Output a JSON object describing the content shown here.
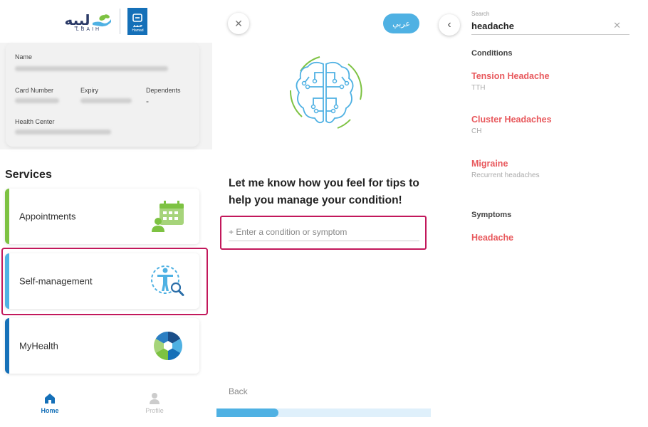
{
  "screen1": {
    "logo": {
      "lbaih_ar": "لبيه",
      "lbaih_en": "LBAIH",
      "hamad_ar": "حمد",
      "hamad_en": "Hamad"
    },
    "card": {
      "name_label": "Name",
      "card_number_label": "Card Number",
      "expiry_label": "Expiry",
      "dependents_label": "Dependents",
      "dependents_value": "-",
      "health_center_label": "Health Center"
    },
    "services_title": "Services",
    "services": [
      {
        "label": "Appointments",
        "accent": "#7dc242",
        "icon": "calendar-user-icon"
      },
      {
        "label": "Self-management",
        "accent": "#4fb1e3",
        "icon": "body-search-icon"
      },
      {
        "label": "MyHealth",
        "accent": "#1570b8",
        "icon": "aperture-icon"
      }
    ],
    "nav": [
      {
        "label": "Home",
        "icon": "home-icon",
        "active": true
      },
      {
        "label": "Profile",
        "icon": "person-icon",
        "active": false
      }
    ]
  },
  "screen2": {
    "language_button": "عربي",
    "prompt": "Let me know how you feel for tips to help you manage your condition!",
    "input_placeholder": "+ Enter a condition or symptom",
    "back_label": "Back",
    "progress_fraction": 0.29
  },
  "screen3": {
    "search_label": "Search",
    "search_value": "headache",
    "conditions_heading": "Conditions",
    "conditions": [
      {
        "title": "Tension Headache",
        "subtitle": "TTH"
      },
      {
        "title": "Cluster Headaches",
        "subtitle": "CH"
      },
      {
        "title": "Migraine",
        "subtitle": "Recurrent headaches"
      }
    ],
    "symptoms_heading": "Symptoms",
    "symptoms": [
      {
        "title": "Headache"
      }
    ]
  },
  "colors": {
    "accent_blue": "#4fb1e3",
    "brand_navy": "#1570b8",
    "highlight_magenta": "#c2185b",
    "result_red": "#e8595d",
    "green": "#7dc242"
  }
}
